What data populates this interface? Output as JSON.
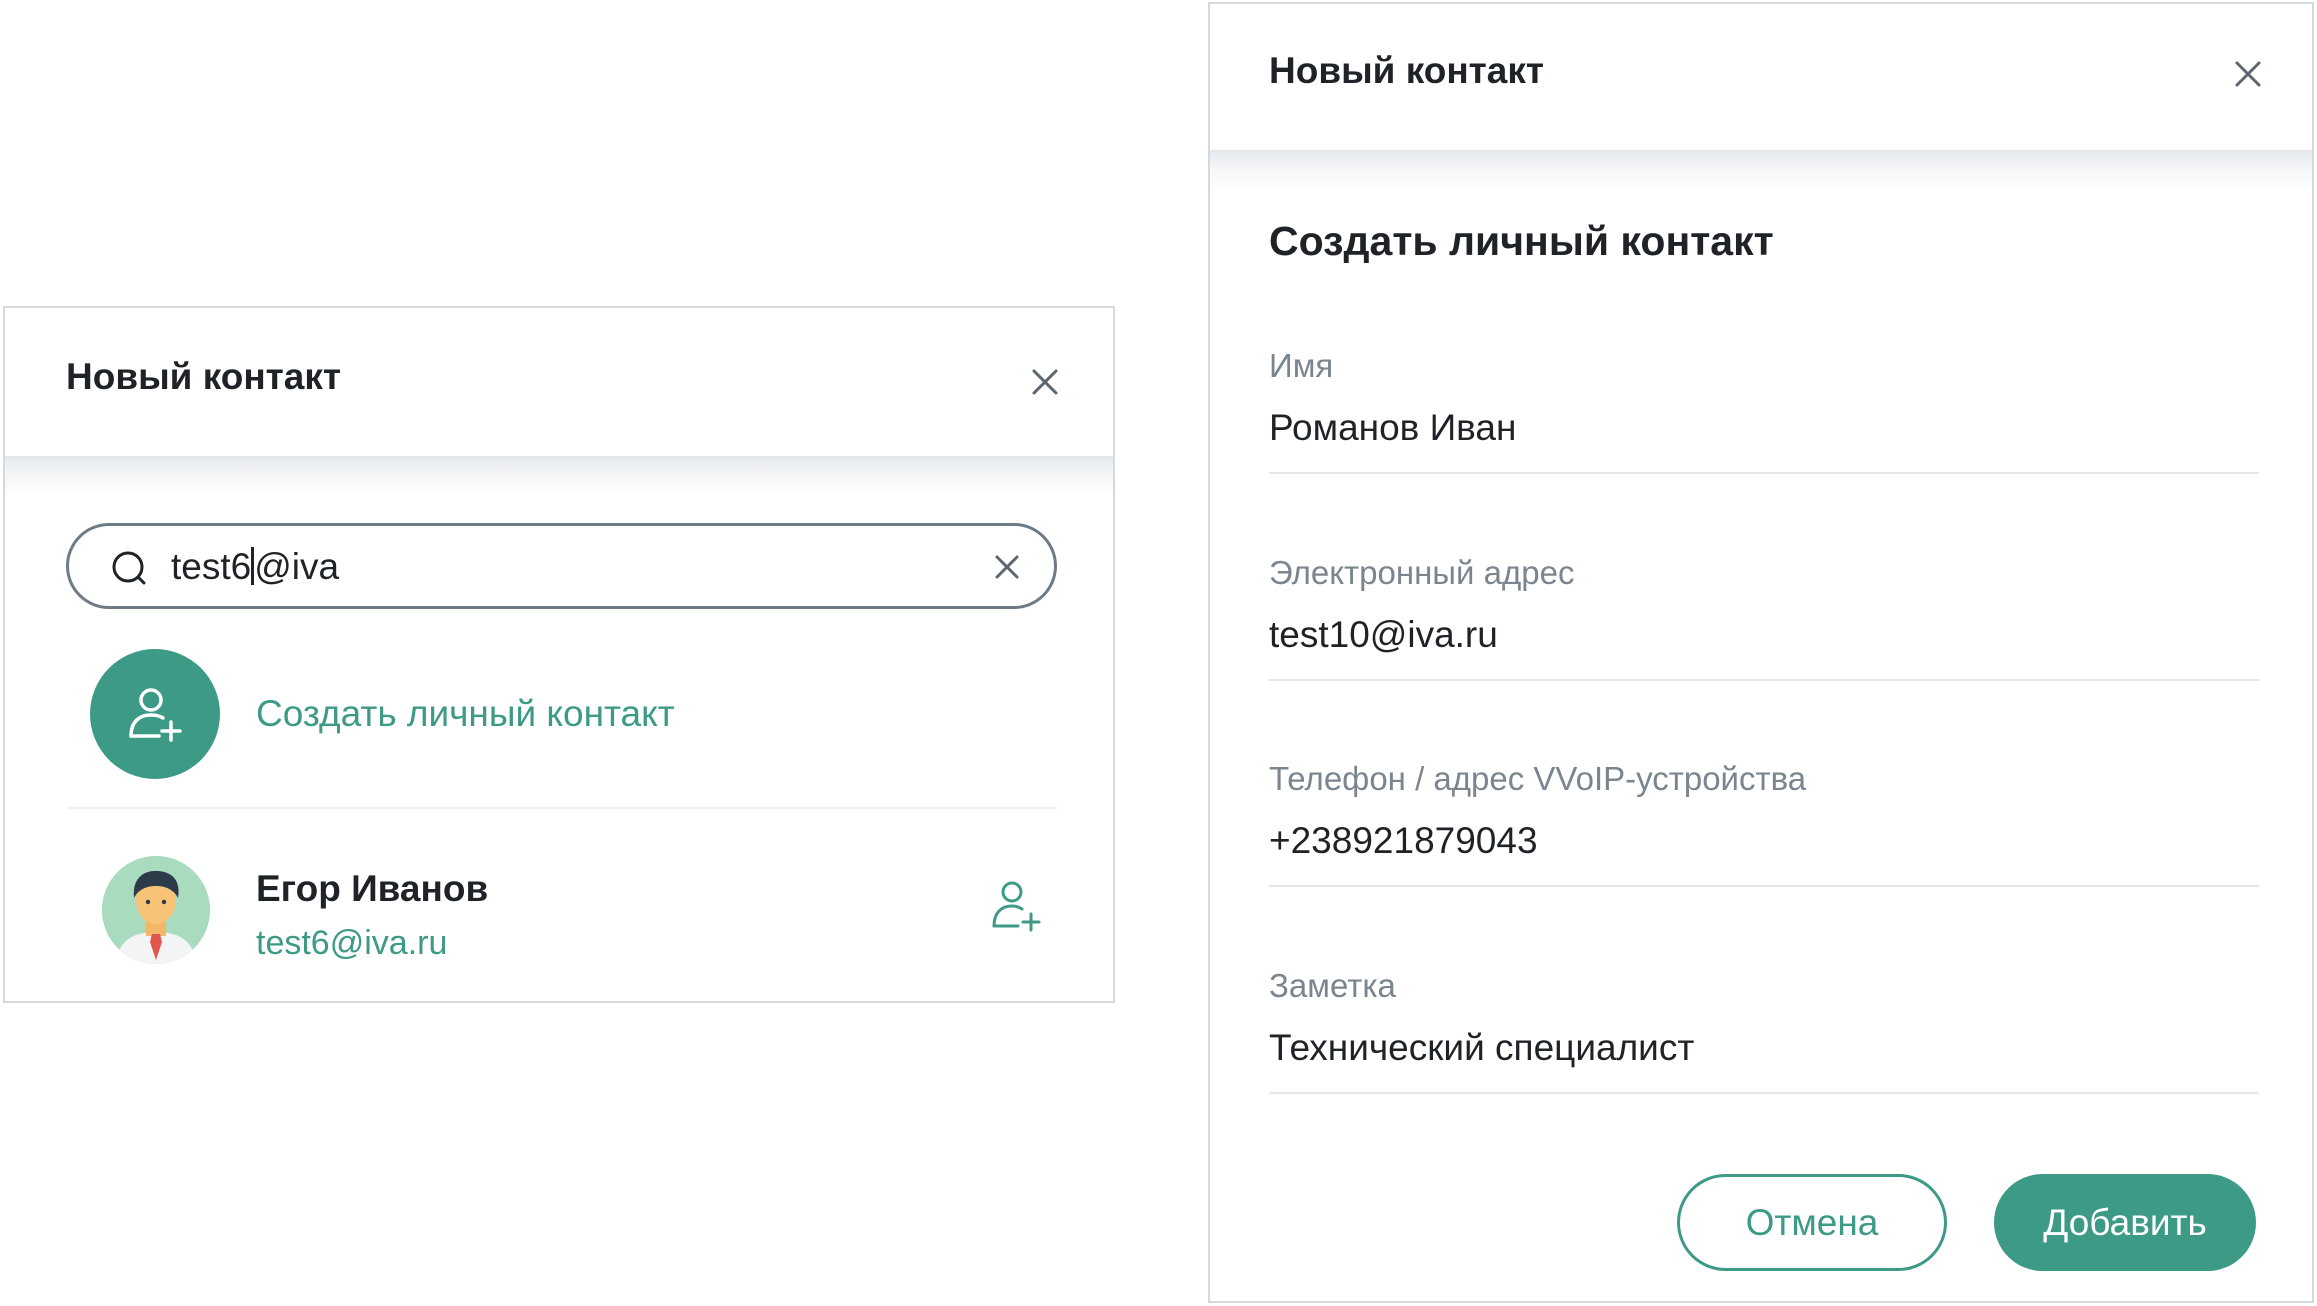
{
  "colors": {
    "accent": "#3d9a86",
    "text": "#1f2327",
    "muted": "#7b858f",
    "border": "#d6d9dc"
  },
  "search_panel": {
    "title": "Новый контакт",
    "close_icon": "close-icon",
    "search": {
      "value_before_caret": "test6",
      "value_after_caret": "@iva",
      "icon": "search-icon",
      "clear_icon": "close-icon"
    },
    "create_contact": {
      "label": "Создать личный контакт",
      "icon": "add-user-icon"
    },
    "results": [
      {
        "name": "Егор Иванов",
        "email": "test6@iva.ru",
        "avatar": "avatar-man",
        "action_icon": "add-user-icon"
      }
    ]
  },
  "form_panel": {
    "title": "Новый контакт",
    "close_icon": "close-icon",
    "section_title": "Создать личный контакт",
    "fields": {
      "name": {
        "label": "Имя",
        "value": "Романов Иван"
      },
      "email": {
        "label": "Электронный адрес",
        "value": "test10@iva.ru"
      },
      "phone": {
        "label": "Телефон / адрес VVoIP-устройства",
        "value": "+238921879043"
      },
      "note": {
        "label": "Заметка",
        "value": "Технический специалист"
      }
    },
    "buttons": {
      "cancel": "Отмена",
      "add": "Добавить"
    }
  }
}
